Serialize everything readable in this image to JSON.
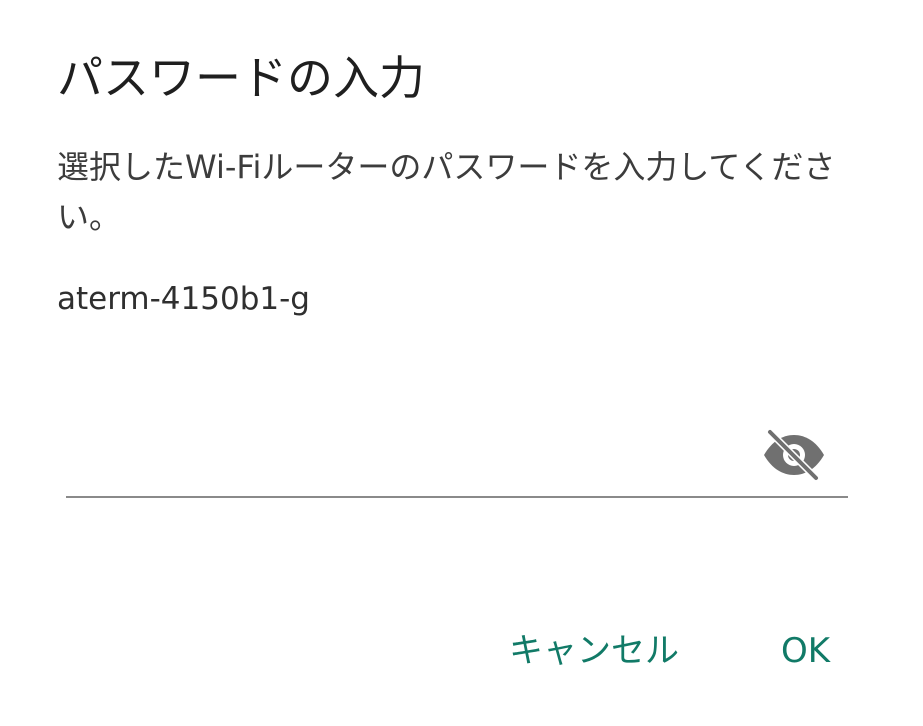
{
  "dialog": {
    "title": "パスワードの入力",
    "message": "選択したWi-Fiルーターのパスワードを入力してください。",
    "ssid": "aterm-4150b1-g",
    "password": {
      "value": "",
      "placeholder": "",
      "visibility_icon": "visibility-off-icon"
    },
    "buttons": {
      "cancel_label": "キャンセル",
      "ok_label": "OK"
    }
  },
  "colors": {
    "accent": "#117a67",
    "underline": "#8a8a8a",
    "icon": "#707070"
  }
}
